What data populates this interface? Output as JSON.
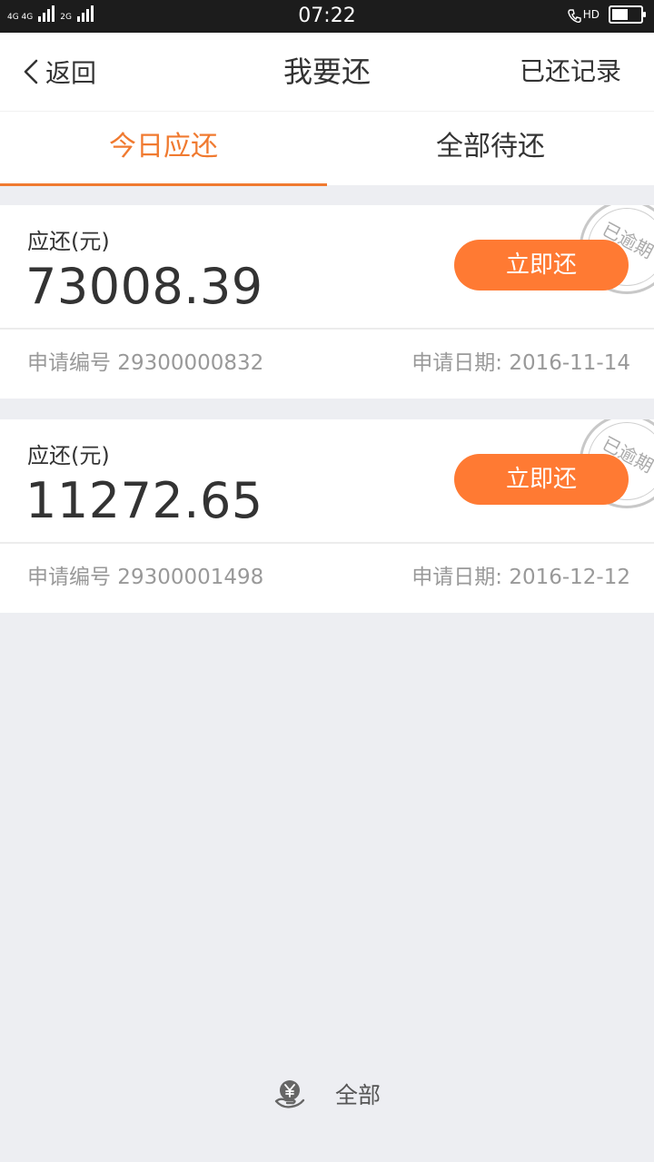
{
  "status_bar": {
    "network1": "4G 4G",
    "network2": "2G",
    "time": "07:22",
    "hd": "HD"
  },
  "nav": {
    "back_label": "返回",
    "title": "我要还",
    "right_label": "已还记录"
  },
  "tabs": [
    {
      "label": "今日应还",
      "active": true
    },
    {
      "label": "全部待还",
      "active": false
    }
  ],
  "cards": [
    {
      "amount_label": "应还(元)",
      "amount": "73008.39",
      "button_label": "立即还",
      "stamp": "已逾期",
      "apply_no": "申请编号 29300000832",
      "apply_date": "申请日期: 2016-11-14"
    },
    {
      "amount_label": "应还(元)",
      "amount": "11272.65",
      "button_label": "立即还",
      "stamp": "已逾期",
      "apply_no": "申请编号 29300001498",
      "apply_date": "申请日期: 2016-12-12"
    }
  ],
  "bottom": {
    "label": "全部",
    "icon": "yen-hand-icon"
  },
  "colors": {
    "accent": "#f07a30",
    "button": "#ff7a33",
    "background": "#edeef2"
  },
  "battery_level": 0.55
}
